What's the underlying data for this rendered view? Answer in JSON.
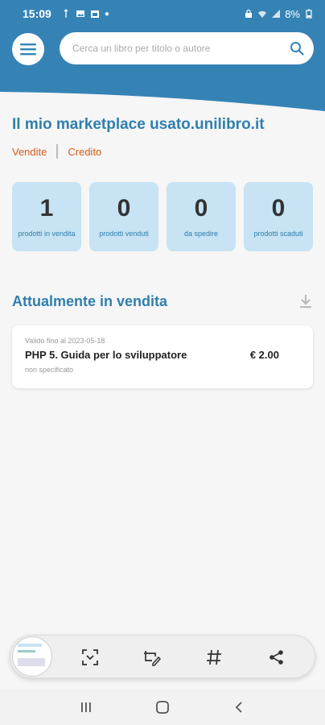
{
  "status": {
    "time": "15:09",
    "battery": "8%"
  },
  "search": {
    "placeholder": "Cerca un libro per titolo o autore",
    "value": ""
  },
  "page": {
    "title": "Il mio marketplace usato.unilibro.it"
  },
  "tabs": [
    {
      "label": "Vendite"
    },
    {
      "label": "Credito"
    }
  ],
  "stats": [
    {
      "value": "1",
      "label": "prodotti in vendita"
    },
    {
      "value": "0",
      "label": "prodotti venduti"
    },
    {
      "value": "0",
      "label": "da spedire"
    },
    {
      "value": "0",
      "label": "prodotti scaduti"
    }
  ],
  "section": {
    "title": "Attualmente in vendita"
  },
  "listings": [
    {
      "valid_until": "Valido fino al 2023-05-18",
      "title": "PHP 5. Guida per lo sviluppatore",
      "price": "€ 2.00",
      "condition": "non specificato"
    }
  ],
  "icons": {
    "menu": "hamburger-menu-icon",
    "search": "search-icon",
    "download": "download-icon",
    "scan": "scan-icon",
    "edit": "edit-icon",
    "hashtag": "hashtag-icon",
    "share": "share-icon"
  },
  "colors": {
    "header": "#3583b5",
    "accent": "#2f7fae",
    "tab": "#d45a16",
    "stat_bg": "#c7e3f4"
  }
}
